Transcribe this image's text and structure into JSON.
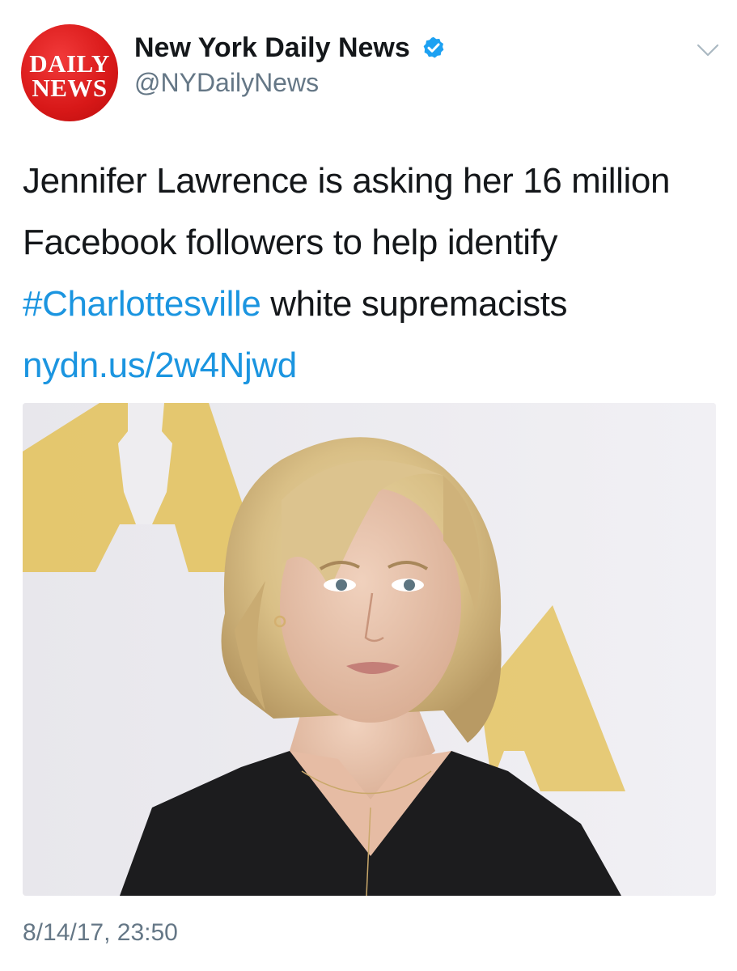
{
  "account": {
    "logo_line1": "DAILY",
    "logo_line2": "NEWS",
    "display_name": "New York Daily News",
    "handle": "@NYDailyNews",
    "verified": true
  },
  "tweet": {
    "text_before_hashtag": "Jennifer Lawrence is asking her 16 million Facebook followers to help identify ",
    "hashtag": "#Charlottesville",
    "text_after_hashtag": " white supremacists ",
    "link": "nydn.us/2w4Njwd",
    "timestamp": "8/14/17, 23:50"
  },
  "colors": {
    "link": "#1b95e0",
    "text": "#14171a",
    "secondary": "#657786",
    "logo_red": "#d81818",
    "verified_blue": "#1da1f2",
    "oscar_gold": "#e3c158"
  },
  "icons": {
    "verified": "verified-badge-icon",
    "menu": "chevron-down-icon"
  }
}
